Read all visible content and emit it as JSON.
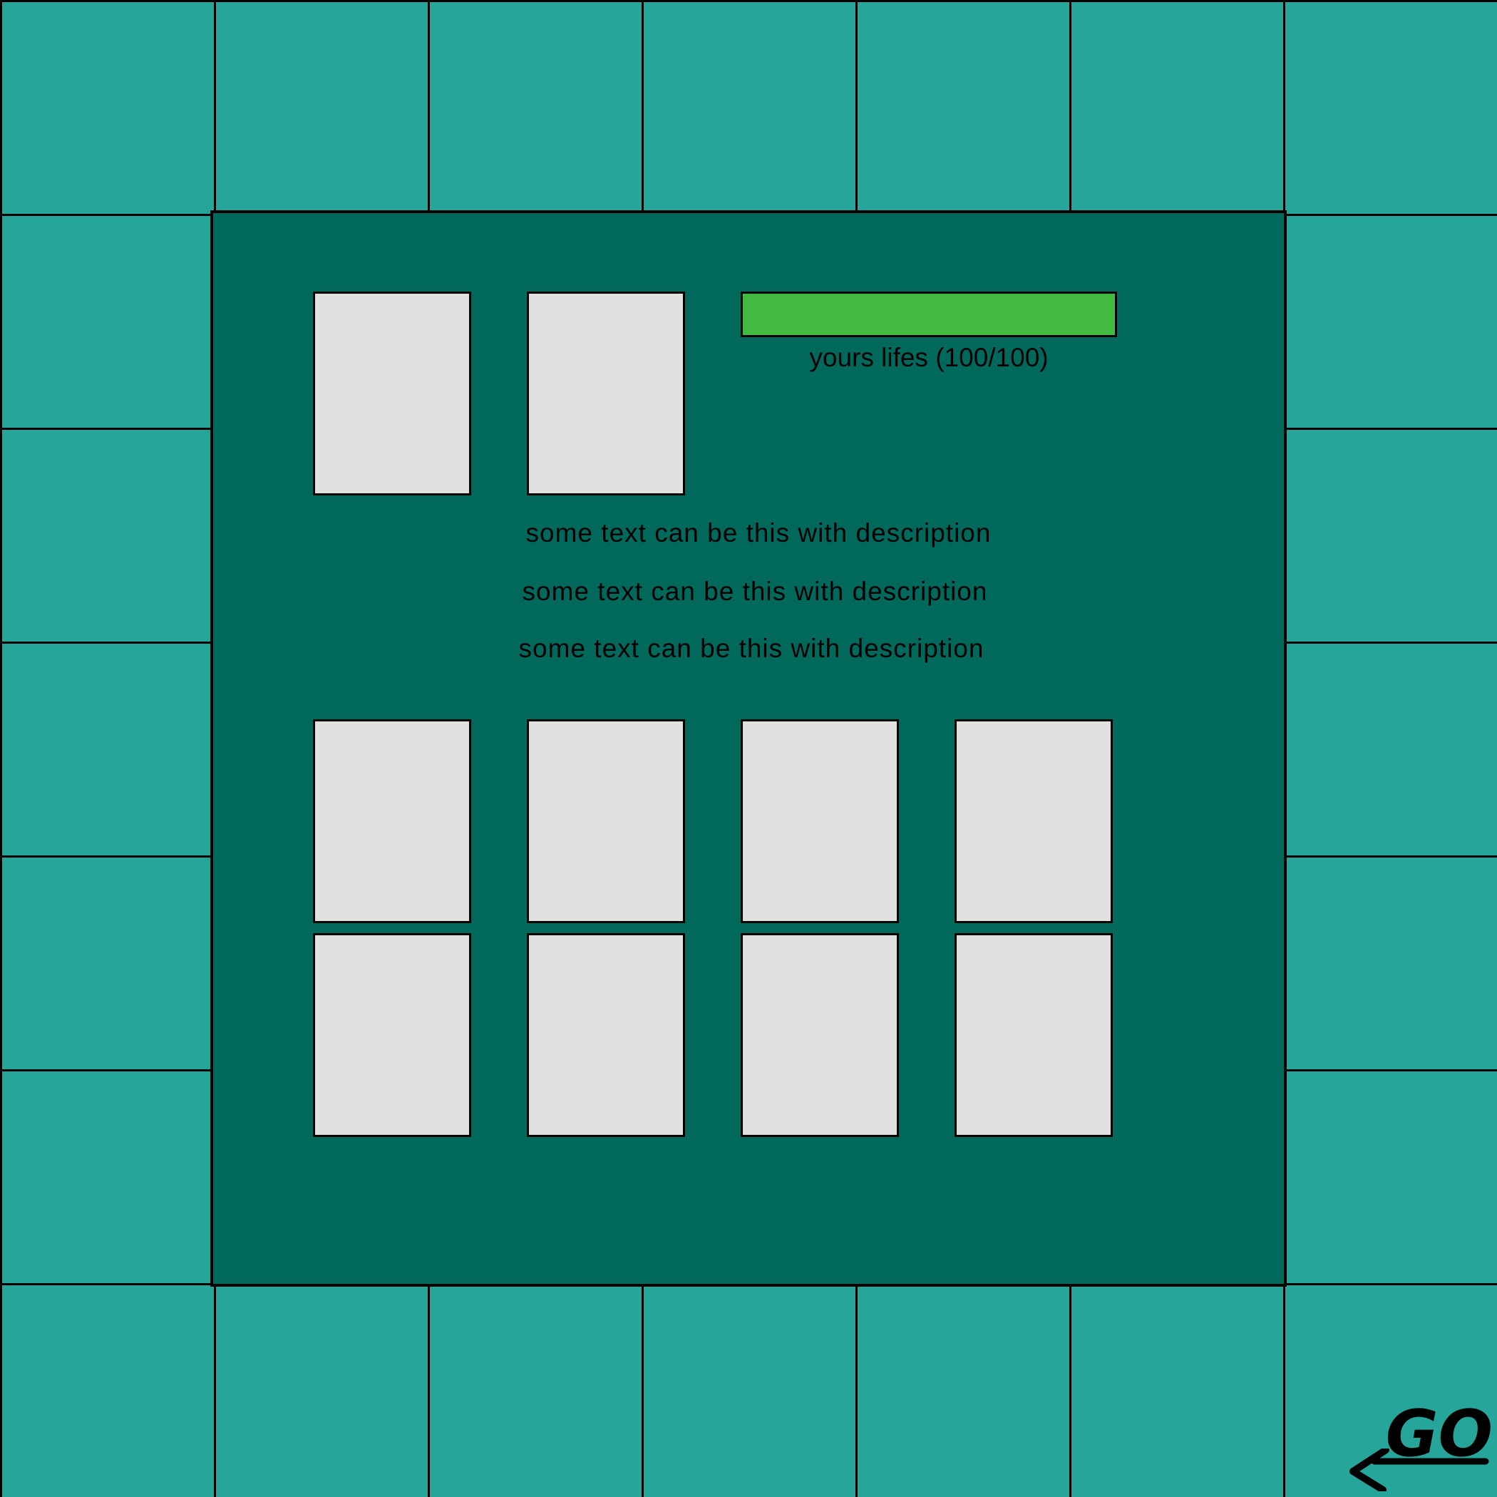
{
  "colors": {
    "outer_tile": "#26a69a",
    "center_panel": "#00695c",
    "card": "#e0e0e0",
    "life_fill": "#43bb43",
    "border": "#000000"
  },
  "player": {
    "life_label": "yours lifes (100/100)",
    "life_current": 100,
    "life_max": 100
  },
  "descriptions": [
    "some text can be this with description",
    "some text can be this with description",
    "some text can be this with description"
  ],
  "cards": {
    "top_row_count": 2,
    "bottom_rows": 2,
    "bottom_columns": 4
  },
  "go_tile": {
    "label": "GO",
    "icon": "arrow-left-icon"
  }
}
